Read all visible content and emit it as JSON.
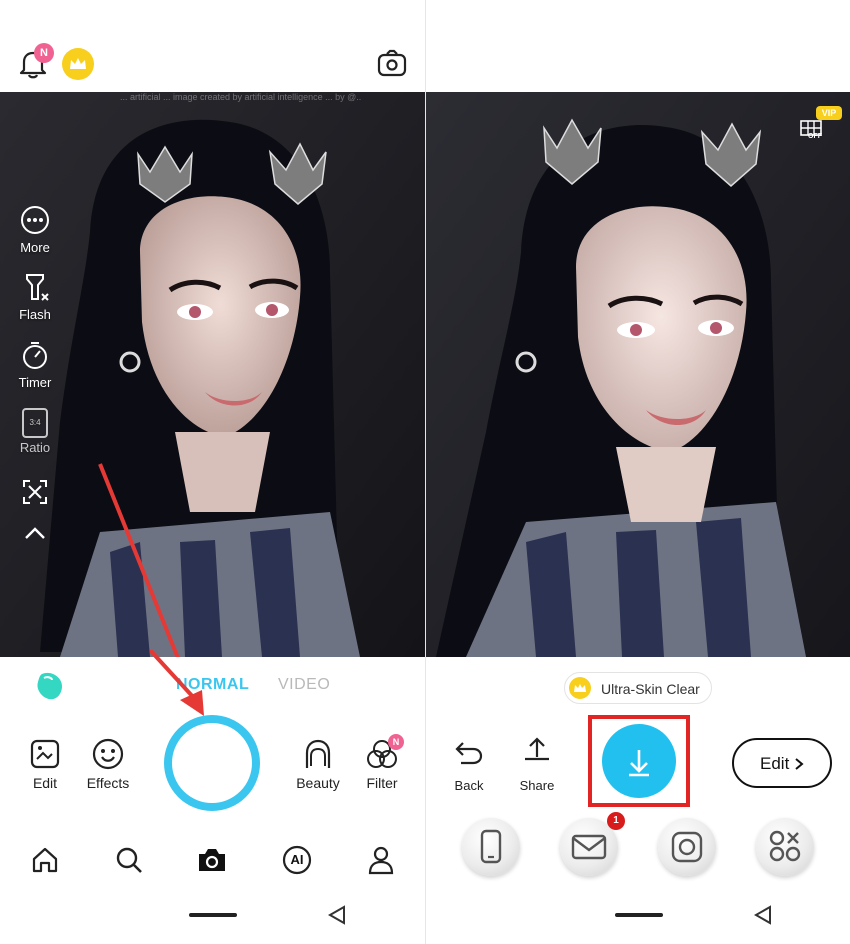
{
  "left": {
    "top": {
      "notification_badge": "N",
      "icons": [
        "bell-icon",
        "crown-icon",
        "camera-flip-icon"
      ]
    },
    "watermark": "... artificial ... image created by artificial intelligence ... by @..",
    "side_tools": [
      {
        "label": "More",
        "icon": "more-icon"
      },
      {
        "label": "Flash",
        "icon": "flash-off-icon"
      },
      {
        "label": "Timer",
        "icon": "timer-icon"
      },
      {
        "label": "Ratio",
        "icon": "ratio-icon",
        "badge": "3:4"
      },
      {
        "label": "",
        "icon": "expand-icon"
      },
      {
        "label": "",
        "icon": "chevron-up-icon"
      }
    ],
    "modes": {
      "normal": "NORMAL",
      "video": "VIDEO"
    },
    "tools": {
      "edit": "Edit",
      "effects": "Effects",
      "beauty": "Beauty",
      "filter": "Filter",
      "filter_badge": "N"
    },
    "bottom_nav": [
      "home-icon",
      "search-icon",
      "camera-icon",
      "ai-icon",
      "profile-icon"
    ],
    "bottom_nav_ai": "AI",
    "accent": "#3bc6ef",
    "arrow_color": "#e53935"
  },
  "right": {
    "vip_badge": "VIP",
    "grid_off_label": "OFF",
    "ultra_skin": "Ultra-Skin Clear",
    "back": "Back",
    "share": "Share",
    "edit": "Edit",
    "mail_badge": "1",
    "share_apps": [
      "phone-icon",
      "mail-icon",
      "instagram-icon",
      "more-apps-icon"
    ],
    "save_button_color": "#22c0ee",
    "highlight_color": "#e32424"
  }
}
